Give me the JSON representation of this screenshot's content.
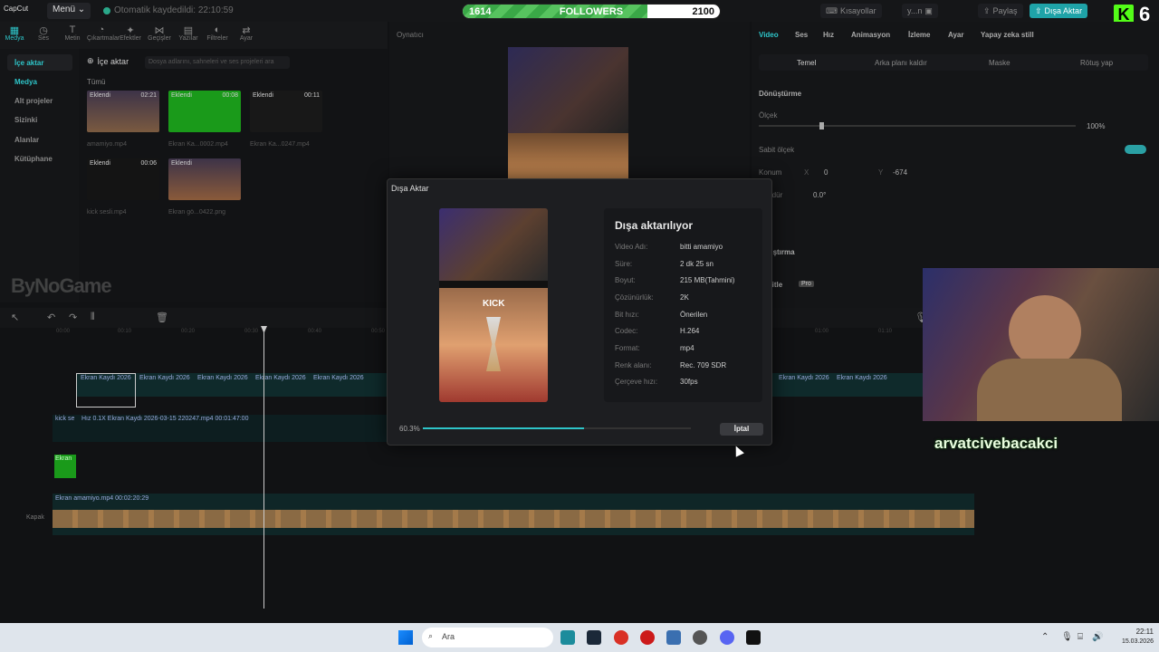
{
  "app": {
    "logo": "CapCut",
    "menu_label": "Menü",
    "autosave": "Otomatik kaydedildi: 22:10:59"
  },
  "followers": {
    "left": "1614",
    "label": "FOLLOWERS",
    "right": "2100",
    "progress": 0.72,
    "color": "#3aa847"
  },
  "top_buttons": {
    "shortcuts": "Kısayollar",
    "user": "y...n",
    "share": "Paylaş",
    "export": "Dışa Aktar"
  },
  "kick": {
    "logo": "K",
    "count": "6",
    "color": "#53fc18"
  },
  "tools": [
    {
      "label": "Medya",
      "icon": "media-icon"
    },
    {
      "label": "Ses",
      "icon": "audio-icon"
    },
    {
      "label": "Metin",
      "icon": "text-icon"
    },
    {
      "label": "Çıkartmalar",
      "icon": "sticker-icon"
    },
    {
      "label": "Efektler",
      "icon": "effects-icon"
    },
    {
      "label": "Geçişler",
      "icon": "transition-icon"
    },
    {
      "label": "Yazılar",
      "icon": "captions-icon"
    },
    {
      "label": "Filtreler",
      "icon": "filters-icon"
    },
    {
      "label": "Ayar",
      "icon": "adjust-icon"
    }
  ],
  "sidebar": [
    "İçe aktar",
    "Medya",
    "Alt projeler",
    "Sizinki",
    "Alanlar",
    "Kütüphane"
  ],
  "media": {
    "import_label": "İçe aktar",
    "search_placeholder": "Dosya adlarını, sahneleri ve ses projeleri ara",
    "all_label": "Tümü",
    "items": [
      {
        "tag": "Eklendi",
        "duration": "02:21",
        "name": "amamiyo.mp4"
      },
      {
        "tag": "Eklendi",
        "duration": "00:08",
        "name": "Ekran Ka...0002.mp4"
      },
      {
        "tag": "Eklendi",
        "duration": "00:11",
        "name": "Ekran Ka...0247.mp4"
      },
      {
        "tag": "Eklendi",
        "duration": "00:06",
        "name": "kick sesli.mp4"
      },
      {
        "tag": "Eklendi",
        "duration": "",
        "name": "Ekran gö...0422.png"
      }
    ]
  },
  "player": {
    "label": "Oynatıcı"
  },
  "right_panel": {
    "tabs": [
      "Video",
      "Ses",
      "Hız",
      "Animasyon",
      "İzleme",
      "Ayar",
      "Yapay zeka still"
    ],
    "subtabs": [
      "Temel",
      "Arka planı kaldır",
      "Maske",
      "Rötuş yap"
    ],
    "transform": "Dönüştürme",
    "scale": "Ölçek",
    "scale_value": "100%",
    "fixed_scale": "Sabit ölçek",
    "position": "Konum",
    "x_label": "X",
    "x_value": "0",
    "y_label": "Y",
    "y_value": "-674",
    "rotate": "Döndür",
    "rotate_value": "0.0°",
    "blend": "Karıştırma",
    "stabilize": "Sabitle",
    "pro": "Pro"
  },
  "timeline": {
    "ruler": [
      "00:00",
      "00:10",
      "00:20",
      "00:30",
      "00:40",
      "00:50",
      "01:00",
      "01:10"
    ],
    "clip_label": "Ekran Kaydı 2026",
    "kick_track": "kick se",
    "speed_label": "Hız 0.1X  Ekran Kaydı 2026-03-15 220247.mp4  00:01:47:00",
    "green_clip": "Ekran",
    "main_clip": "Ekran  amamiyo.mp4  00:02:20:29",
    "cover_label": "Kapak"
  },
  "dialog": {
    "title": "Dışa Aktar",
    "heading": "Dışa aktarılıyor",
    "info": [
      {
        "k": "Video Adı:",
        "v": "bitti amamiyo"
      },
      {
        "k": "Süre:",
        "v": "2 dk 25 sn"
      },
      {
        "k": "Boyut:",
        "v": "215 MB(Tahmini)"
      },
      {
        "k": "Çözünürlük:",
        "v": "2K"
      },
      {
        "k": "Bit hızı:",
        "v": "Önerilen"
      },
      {
        "k": "Codec:",
        "v": "H.264"
      },
      {
        "k": "Format:",
        "v": "mp4"
      },
      {
        "k": "Renk alanı:",
        "v": "Rec. 709 SDR"
      },
      {
        "k": "Çerçeve hızı:",
        "v": "30fps"
      }
    ],
    "progress_label": "60.3%",
    "progress": 0.603,
    "cancel": "İptal",
    "preview_text": "KICK"
  },
  "overlay": {
    "name": "arvatcivebacakci",
    "watermark": "ByNoGame"
  },
  "taskbar": {
    "search": "Ara",
    "time": "22:11",
    "date": "15.03.2026"
  }
}
